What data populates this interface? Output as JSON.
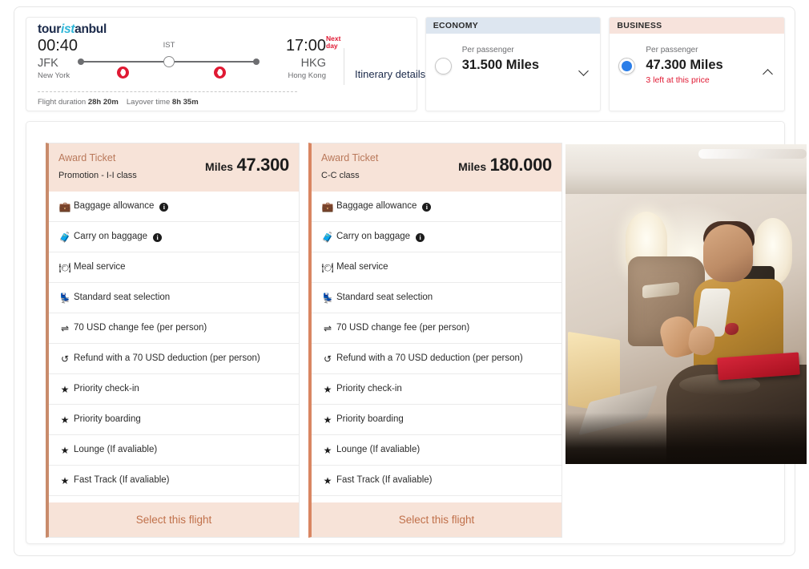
{
  "brand": {
    "part1": "tour",
    "part2": "ist",
    "part3": "anbul"
  },
  "flight": {
    "depart_time": "00:40",
    "depart_code": "JFK",
    "depart_city": "New York",
    "arrive_time": "17:00",
    "arrive_badge_line1": "Next",
    "arrive_badge_line2": "day",
    "arrive_code": "HKG",
    "arrive_city": "Hong Kong",
    "stop_code": "IST",
    "duration_label": "Flight duration",
    "duration_value": "28h 20m",
    "layover_label": "Layover time",
    "layover_value": "8h 35m",
    "itinerary_label": "Itinerary details"
  },
  "fares": [
    {
      "cabin": "ECONOMY",
      "per_passenger": "Per passenger",
      "miles": "31.500 Miles",
      "note": "",
      "selected": false,
      "chevron": "chevron-down"
    },
    {
      "cabin": "BUSINESS",
      "per_passenger": "Per passenger",
      "miles": "47.300 Miles",
      "note": "3 left at this price",
      "selected": true,
      "chevron": "chevron-up"
    }
  ],
  "tickets": [
    {
      "title": "Award Ticket",
      "subtitle": "Promotion - I-I class",
      "miles_word": "Miles",
      "miles_value": "47.300",
      "select_label": "Select this flight",
      "features": [
        {
          "icon": "suitcase-icon",
          "glyph": "💼",
          "label": "Baggage allowance",
          "info": true
        },
        {
          "icon": "carryon-icon",
          "glyph": "🧳",
          "label": "Carry on baggage",
          "info": true
        },
        {
          "icon": "meal-icon",
          "glyph": "🍽",
          "label": "Meal service",
          "info": false
        },
        {
          "icon": "seat-icon",
          "glyph": "💺",
          "label": "Standard seat selection",
          "info": false
        },
        {
          "icon": "change-fee-icon",
          "glyph": "⇌",
          "label": "70 USD change fee (per person)",
          "info": false
        },
        {
          "icon": "refund-icon",
          "glyph": "↺",
          "label": "Refund with a 70 USD deduction (per person)",
          "info": false
        },
        {
          "icon": "star-icon",
          "glyph": "★",
          "label": "Priority check-in",
          "info": false
        },
        {
          "icon": "star-icon",
          "glyph": "★",
          "label": "Priority boarding",
          "info": false
        },
        {
          "icon": "star-icon",
          "glyph": "★",
          "label": "Lounge (If avaliable)",
          "info": false
        },
        {
          "icon": "star-icon",
          "glyph": "★",
          "label": "Fast Track (If avaliable)",
          "info": false
        }
      ]
    },
    {
      "title": "Award Ticket",
      "subtitle": "C-C class",
      "miles_word": "Miles",
      "miles_value": "180.000",
      "select_label": "Select this flight",
      "features": [
        {
          "icon": "suitcase-icon",
          "glyph": "💼",
          "label": "Baggage allowance",
          "info": true
        },
        {
          "icon": "carryon-icon",
          "glyph": "🧳",
          "label": "Carry on baggage",
          "info": true
        },
        {
          "icon": "meal-icon",
          "glyph": "🍽",
          "label": "Meal service",
          "info": false
        },
        {
          "icon": "seat-icon",
          "glyph": "💺",
          "label": "Standard seat selection",
          "info": false
        },
        {
          "icon": "change-fee-icon",
          "glyph": "⇌",
          "label": "70 USD change fee (per person)",
          "info": false
        },
        {
          "icon": "refund-icon",
          "glyph": "↺",
          "label": "Refund with a 70 USD deduction (per person)",
          "info": false
        },
        {
          "icon": "star-icon",
          "glyph": "★",
          "label": "Priority check-in",
          "info": false
        },
        {
          "icon": "star-icon",
          "glyph": "★",
          "label": "Priority boarding",
          "info": false
        },
        {
          "icon": "star-icon",
          "glyph": "★",
          "label": "Lounge (If avaliable)",
          "info": false
        },
        {
          "icon": "star-icon",
          "glyph": "★",
          "label": "Fast Track (If avaliable)",
          "info": false
        }
      ]
    }
  ],
  "promo_image": "business-class-cabin-photo",
  "colors": {
    "brand_cyan": "#2fb6d8",
    "brand_navy": "#1b2a4a",
    "alert_red": "#e01933",
    "economy_header": "#dde6f0",
    "business_header": "#f7e3dc",
    "ticket_header": "#f7e3d8",
    "ticket_accent": "#c98b6b",
    "select_text": "#c0704a",
    "radio_selected": "#2b7ee8"
  }
}
